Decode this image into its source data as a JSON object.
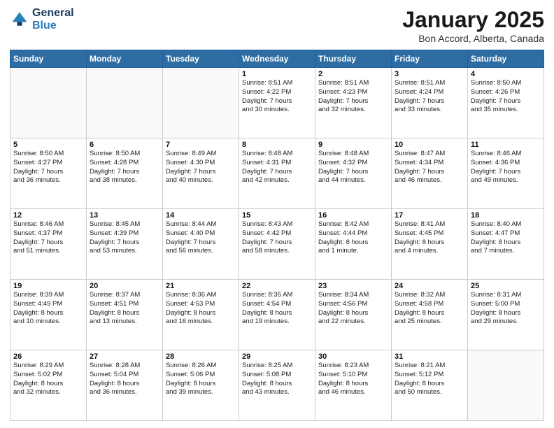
{
  "header": {
    "logo_line1": "General",
    "logo_line2": "Blue",
    "month": "January 2025",
    "location": "Bon Accord, Alberta, Canada"
  },
  "days_of_week": [
    "Sunday",
    "Monday",
    "Tuesday",
    "Wednesday",
    "Thursday",
    "Friday",
    "Saturday"
  ],
  "weeks": [
    [
      {
        "num": "",
        "info": "",
        "empty": true
      },
      {
        "num": "",
        "info": "",
        "empty": true
      },
      {
        "num": "",
        "info": "",
        "empty": true
      },
      {
        "num": "1",
        "info": "Sunrise: 8:51 AM\nSunset: 4:22 PM\nDaylight: 7 hours\nand 30 minutes."
      },
      {
        "num": "2",
        "info": "Sunrise: 8:51 AM\nSunset: 4:23 PM\nDaylight: 7 hours\nand 32 minutes."
      },
      {
        "num": "3",
        "info": "Sunrise: 8:51 AM\nSunset: 4:24 PM\nDaylight: 7 hours\nand 33 minutes."
      },
      {
        "num": "4",
        "info": "Sunrise: 8:50 AM\nSunset: 4:26 PM\nDaylight: 7 hours\nand 35 minutes."
      }
    ],
    [
      {
        "num": "5",
        "info": "Sunrise: 8:50 AM\nSunset: 4:27 PM\nDaylight: 7 hours\nand 36 minutes."
      },
      {
        "num": "6",
        "info": "Sunrise: 8:50 AM\nSunset: 4:28 PM\nDaylight: 7 hours\nand 38 minutes."
      },
      {
        "num": "7",
        "info": "Sunrise: 8:49 AM\nSunset: 4:30 PM\nDaylight: 7 hours\nand 40 minutes."
      },
      {
        "num": "8",
        "info": "Sunrise: 8:48 AM\nSunset: 4:31 PM\nDaylight: 7 hours\nand 42 minutes."
      },
      {
        "num": "9",
        "info": "Sunrise: 8:48 AM\nSunset: 4:32 PM\nDaylight: 7 hours\nand 44 minutes."
      },
      {
        "num": "10",
        "info": "Sunrise: 8:47 AM\nSunset: 4:34 PM\nDaylight: 7 hours\nand 46 minutes."
      },
      {
        "num": "11",
        "info": "Sunrise: 8:46 AM\nSunset: 4:36 PM\nDaylight: 7 hours\nand 49 minutes."
      }
    ],
    [
      {
        "num": "12",
        "info": "Sunrise: 8:46 AM\nSunset: 4:37 PM\nDaylight: 7 hours\nand 51 minutes."
      },
      {
        "num": "13",
        "info": "Sunrise: 8:45 AM\nSunset: 4:39 PM\nDaylight: 7 hours\nand 53 minutes."
      },
      {
        "num": "14",
        "info": "Sunrise: 8:44 AM\nSunset: 4:40 PM\nDaylight: 7 hours\nand 56 minutes."
      },
      {
        "num": "15",
        "info": "Sunrise: 8:43 AM\nSunset: 4:42 PM\nDaylight: 7 hours\nand 58 minutes."
      },
      {
        "num": "16",
        "info": "Sunrise: 8:42 AM\nSunset: 4:44 PM\nDaylight: 8 hours\nand 1 minute."
      },
      {
        "num": "17",
        "info": "Sunrise: 8:41 AM\nSunset: 4:45 PM\nDaylight: 8 hours\nand 4 minutes."
      },
      {
        "num": "18",
        "info": "Sunrise: 8:40 AM\nSunset: 4:47 PM\nDaylight: 8 hours\nand 7 minutes."
      }
    ],
    [
      {
        "num": "19",
        "info": "Sunrise: 8:39 AM\nSunset: 4:49 PM\nDaylight: 8 hours\nand 10 minutes."
      },
      {
        "num": "20",
        "info": "Sunrise: 8:37 AM\nSunset: 4:51 PM\nDaylight: 8 hours\nand 13 minutes."
      },
      {
        "num": "21",
        "info": "Sunrise: 8:36 AM\nSunset: 4:53 PM\nDaylight: 8 hours\nand 16 minutes."
      },
      {
        "num": "22",
        "info": "Sunrise: 8:35 AM\nSunset: 4:54 PM\nDaylight: 8 hours\nand 19 minutes."
      },
      {
        "num": "23",
        "info": "Sunrise: 8:34 AM\nSunset: 4:56 PM\nDaylight: 8 hours\nand 22 minutes."
      },
      {
        "num": "24",
        "info": "Sunrise: 8:32 AM\nSunset: 4:58 PM\nDaylight: 8 hours\nand 25 minutes."
      },
      {
        "num": "25",
        "info": "Sunrise: 8:31 AM\nSunset: 5:00 PM\nDaylight: 8 hours\nand 29 minutes."
      }
    ],
    [
      {
        "num": "26",
        "info": "Sunrise: 8:29 AM\nSunset: 5:02 PM\nDaylight: 8 hours\nand 32 minutes."
      },
      {
        "num": "27",
        "info": "Sunrise: 8:28 AM\nSunset: 5:04 PM\nDaylight: 8 hours\nand 36 minutes."
      },
      {
        "num": "28",
        "info": "Sunrise: 8:26 AM\nSunset: 5:06 PM\nDaylight: 8 hours\nand 39 minutes."
      },
      {
        "num": "29",
        "info": "Sunrise: 8:25 AM\nSunset: 5:08 PM\nDaylight: 8 hours\nand 43 minutes."
      },
      {
        "num": "30",
        "info": "Sunrise: 8:23 AM\nSunset: 5:10 PM\nDaylight: 8 hours\nand 46 minutes."
      },
      {
        "num": "31",
        "info": "Sunrise: 8:21 AM\nSunset: 5:12 PM\nDaylight: 8 hours\nand 50 minutes."
      },
      {
        "num": "",
        "info": "",
        "empty": true
      }
    ]
  ]
}
